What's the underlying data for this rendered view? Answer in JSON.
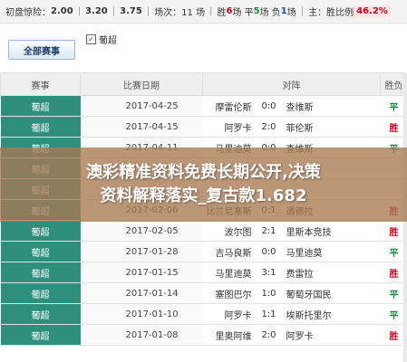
{
  "summary": {
    "handicap_label": "初盘惊险：",
    "odds": [
      "2.00",
      "3.20",
      "3.75"
    ],
    "matches": "场次：11 场",
    "win_label": "胜",
    "wins": "6",
    "draw_label": "场 平",
    "draws": "5",
    "loss_label": "场 负",
    "losses": "1",
    "end_label": "场",
    "ratio_label": "主：胜比例",
    "ratio": "46.2%"
  },
  "filter": {
    "all_button": "全部赛事",
    "league_label": "葡超",
    "league_checked": "✓"
  },
  "table": {
    "headers": [
      "赛事",
      "比赛日期",
      "对阵",
      "胜负"
    ],
    "rows": [
      {
        "league": "葡超",
        "date": "2017-04-25",
        "home": "摩雷伦斯",
        "score": "0:0",
        "away": "查维斯",
        "result": "平",
        "kind": "draw"
      },
      {
        "league": "葡超",
        "date": "2017-04-15",
        "home": "阿罗卡",
        "score": "2:0",
        "away": "菲伦斯",
        "result": "胜",
        "kind": "win"
      },
      {
        "league": "葡超",
        "date": "2017-04-11",
        "home": "马里迪莫",
        "score": "0:0",
        "away": "查维斯",
        "result": "平",
        "kind": "draw"
      },
      {
        "league": "葡超",
        "date": "",
        "home": "",
        "score": "",
        "away": "",
        "result": "",
        "kind": "draw"
      },
      {
        "league": "葡超",
        "date": "",
        "home": "",
        "score": "",
        "away": "",
        "result": "",
        "kind": "draw"
      },
      {
        "league": "葡超",
        "date": "2017-02-06",
        "home": "比兰尼塞斯",
        "score": "0:1",
        "away": "通德拉",
        "result": "胜",
        "kind": "win"
      },
      {
        "league": "葡超",
        "date": "2017-02-05",
        "home": "波尔图",
        "score": "2:1",
        "away": "里斯本竞技",
        "result": "胜",
        "kind": "win"
      },
      {
        "league": "葡超",
        "date": "2017-01-28",
        "home": "吉马良斯",
        "score": "0:0",
        "away": "马里迪莫",
        "result": "平",
        "kind": "draw"
      },
      {
        "league": "葡超",
        "date": "2017-01-15",
        "home": "马里迪莫",
        "score": "3:1",
        "away": "费雷拉",
        "result": "胜",
        "kind": "win"
      },
      {
        "league": "葡超",
        "date": "2017-01-14",
        "home": "塞图巴尔",
        "score": "1:0",
        "away": "葡萄牙国民",
        "result": "平",
        "kind": "draw"
      },
      {
        "league": "葡超",
        "date": "2017-01-10",
        "home": "阿罗卡",
        "score": "1:1",
        "away": "埃斯托里尔",
        "result": "平",
        "kind": "draw"
      },
      {
        "league": "葡超",
        "date": "2017-01-08",
        "home": "里奥阿维",
        "score": "2:0",
        "away": "阿罗卡",
        "result": "胜",
        "kind": "win"
      }
    ]
  },
  "banner": {
    "line1": "澳彩精准资料免费长期公开,决策",
    "line2": "资料解释落实_复古款1.682"
  },
  "colors": {
    "league_cell": "#2f8f7d",
    "win": "#d0021b",
    "draw": "#1a8f3c",
    "overlay": "#a87a52"
  }
}
